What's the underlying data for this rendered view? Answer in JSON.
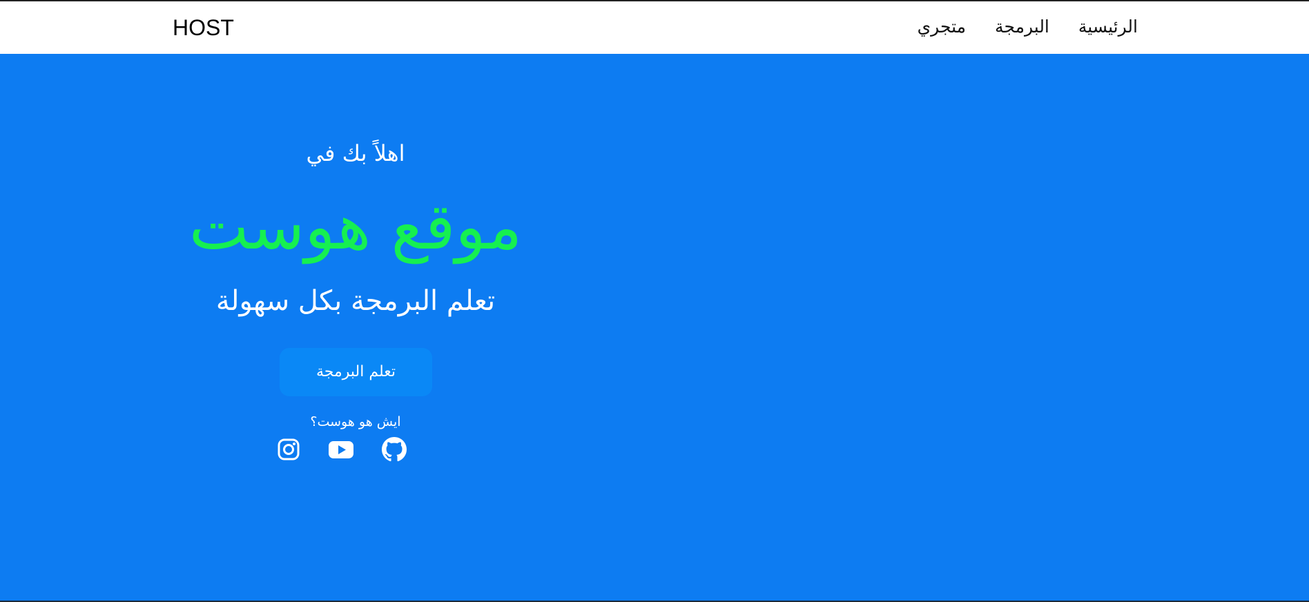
{
  "nav": {
    "brand": "HOST",
    "links": [
      {
        "label": "الرئيسية"
      },
      {
        "label": "البرمجة"
      },
      {
        "label": "متجري"
      }
    ]
  },
  "hero": {
    "welcome": "اهلاً بك في",
    "site_name": "موقع هوست",
    "tagline": "تعلم البرمجة بكل سهولة",
    "cta_label": "تعلم البرمجة",
    "about_link": "ايش هو هوست؟",
    "social_icons": [
      "instagram-icon",
      "youtube-icon",
      "github-icon"
    ]
  },
  "colors": {
    "hero_background": "#0d7cf2",
    "accent_green": "#16f050",
    "button_background": "#0a88f6",
    "navbar_background": "#ffffff"
  }
}
